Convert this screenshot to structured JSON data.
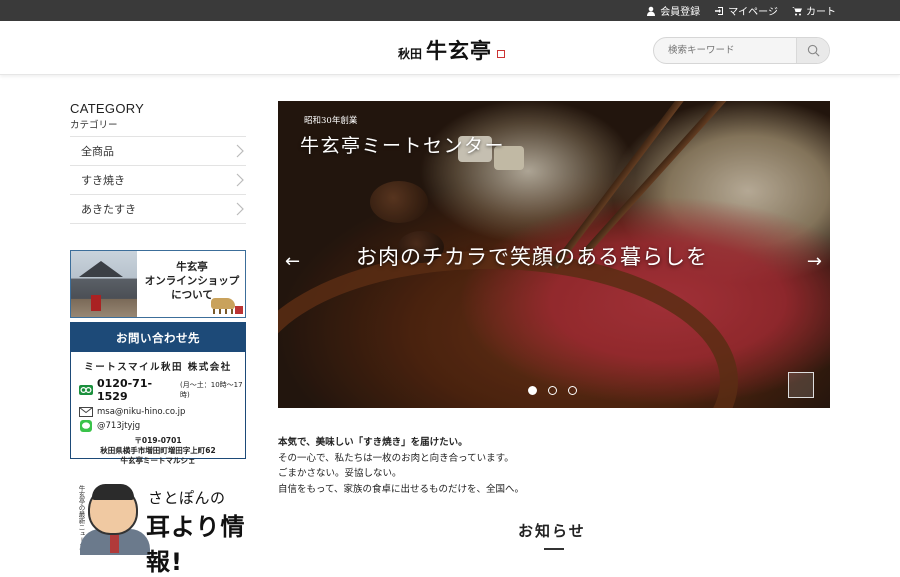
{
  "topbar": {
    "register": "会員登録",
    "mypage": "マイページ",
    "cart": "カート"
  },
  "header": {
    "logo_small": "秋田",
    "logo_big": "牛玄亭",
    "search_placeholder": "検索キーワード"
  },
  "sidebar": {
    "category_title": "CATEGORY",
    "category_sub": "カテゴリー",
    "items": [
      {
        "label": "全商品"
      },
      {
        "label": "すき焼き"
      },
      {
        "label": "あきたすき"
      }
    ],
    "about_banner": {
      "line1": "牛玄亭",
      "line2": "オンラインショップ",
      "line3": "について"
    },
    "contact": {
      "header": "お問い合わせ先",
      "company": "ミートスマイル秋田 株式会社",
      "tel": "0120-71-1529",
      "tel_note": "(月〜土：10時〜17時)",
      "email": "msa@niku-hino.co.jp",
      "line": "@713jtyjg",
      "postal": "〒019-0701",
      "address": "秋田県横手市増田町増田字上町62",
      "shop": "牛玄亭ミートマルシェ"
    },
    "satopon": {
      "vertical": "牛玄亭の最新ニュース",
      "name": "さとぽんの",
      "big": "耳より情報!"
    }
  },
  "hero": {
    "established": "昭和30年創業",
    "title": "牛玄亭ミートセンター",
    "catchphrase": "お肉のチカラで笑顔のある暮らしを",
    "prev": "←",
    "next": "→",
    "slides": 3,
    "active_slide": 1
  },
  "intro": {
    "lead": "本気で、美味しい「すき焼き」を届けたい。",
    "line2": "その一心で、私たちは一枚のお肉と向き合っています。",
    "line3": "ごまかさない。妥協しない。",
    "line4": "自信をもって、家族の食卓に出せるものだけを、全国へ。"
  },
  "news": {
    "title": "お知らせ"
  }
}
